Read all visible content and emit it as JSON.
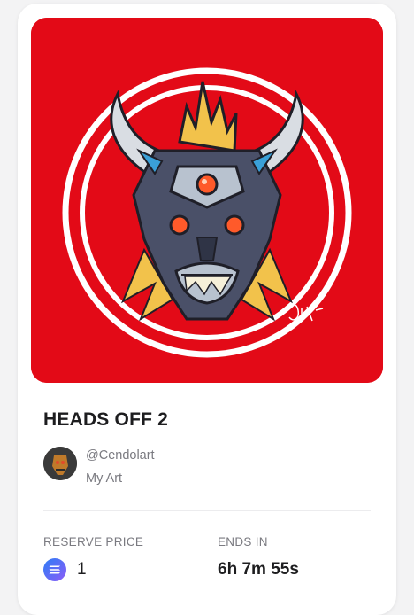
{
  "nft": {
    "title": "HEADS OFF 2",
    "artwork_signature": "Cendol",
    "creator_handle": "@Cendolart",
    "collection": "My Art"
  },
  "auction": {
    "reserve_label": "RESERVE PRICE",
    "reserve_value": "1",
    "currency_icon": "solana-icon",
    "ends_label": "ENDS IN",
    "ends_value": "6h 7m 55s"
  },
  "colors": {
    "art_background": "#e30a17",
    "text_primary": "#1d1d1f",
    "text_secondary": "#7a7a80"
  }
}
